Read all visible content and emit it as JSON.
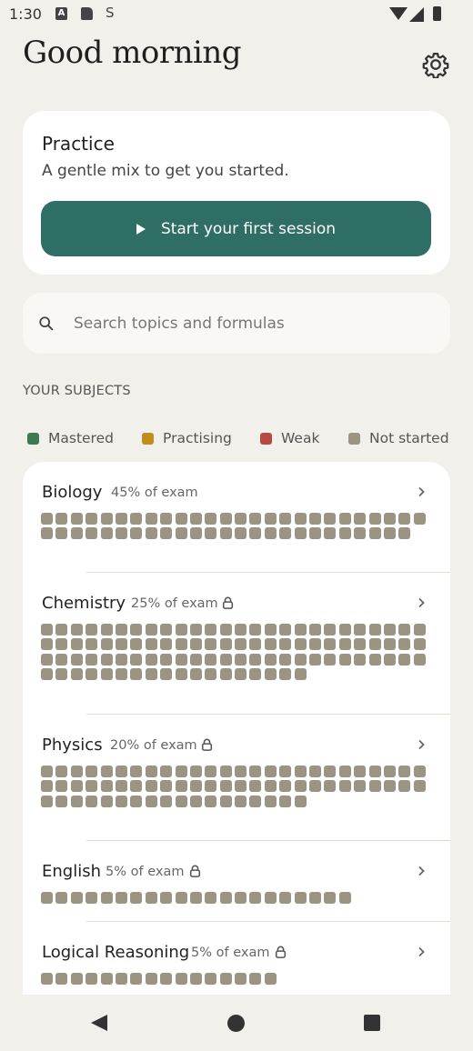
{
  "status_bar": {
    "time": "1:30",
    "icon_a_label": "A",
    "icon_s_label": "S"
  },
  "header": {
    "greeting": "Good morning",
    "settings_icon": "gear-icon"
  },
  "practice": {
    "title": "Practice",
    "subtitle": "A gentle mix to get you started.",
    "start_button": "Start your first session"
  },
  "search": {
    "placeholder": "Search topics and formulas"
  },
  "section_title": "YOUR SUBJECTS",
  "legend": [
    {
      "label": "Mastered",
      "color": "#3d7a52"
    },
    {
      "label": "Practising",
      "color": "#c08f1a"
    },
    {
      "label": "Weak",
      "color": "#b64a43"
    },
    {
      "label": "Not started",
      "color": "#9b9482"
    }
  ],
  "subjects": [
    {
      "name": "Biology",
      "share": "45% of exam",
      "locked": false,
      "topics": 51
    },
    {
      "name": "Chemistry",
      "share": "25% of exam",
      "locked": true,
      "topics": 96
    },
    {
      "name": "Physics",
      "share": "20% of exam",
      "locked": true,
      "topics": 70
    },
    {
      "name": "English",
      "share": "5% of exam",
      "locked": true,
      "topics": 21
    },
    {
      "name": "Logical Reasoning",
      "share": "5% of exam",
      "locked": true,
      "topics": 16
    }
  ]
}
